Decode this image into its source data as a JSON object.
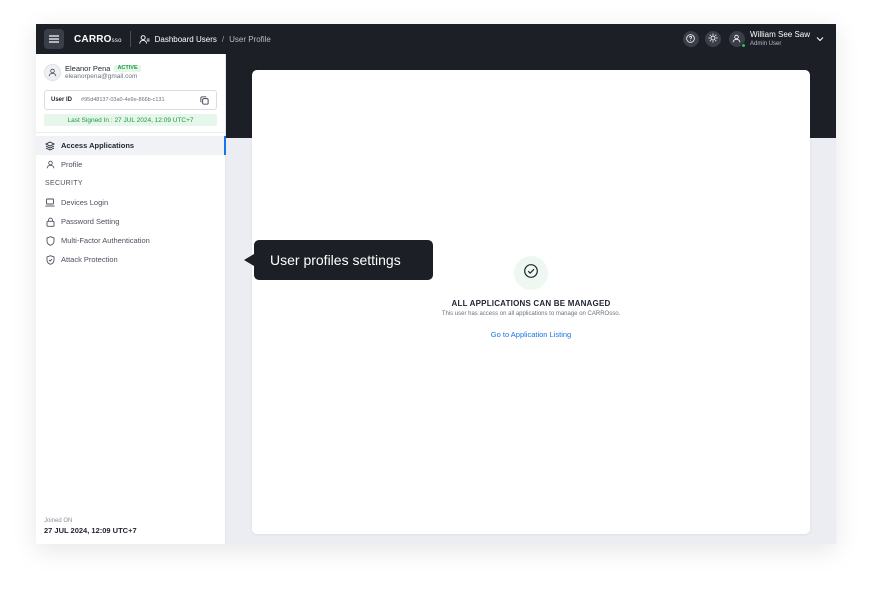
{
  "topbar": {
    "brand": "CARRO",
    "brand_suffix": "sso",
    "breadcrumb": {
      "section": "Dashboard Users",
      "separator": "/",
      "current": "User Profile"
    },
    "icons": [
      "menu-icon",
      "users-icon",
      "help-icon",
      "sun-icon",
      "user-icon",
      "chevron-down-icon"
    ],
    "user": {
      "name": "William See Saw",
      "role": "Admin User"
    }
  },
  "sidebar": {
    "profile": {
      "name": "Eleanor Pena",
      "status": "ACTIVE",
      "email": "eleanorpena@gmail.com"
    },
    "user_id": {
      "label": "User ID",
      "value": "#95d48137-03a0-4e9e-866b-c131"
    },
    "last_signed": "Last Signed In : 27 JUL 2024, 12:09 UTC+7",
    "nav": [
      {
        "label": "Access Applications",
        "icon": "layers-icon",
        "active": true
      },
      {
        "label": "Profile",
        "icon": "user-icon"
      }
    ],
    "security_label": "SECURITY",
    "security_nav": [
      {
        "label": "Devices Login",
        "icon": "laptop-icon"
      },
      {
        "label": "Password Setting",
        "icon": "lock-icon"
      },
      {
        "label": "Multi-Factor Authentication",
        "icon": "shield-icon"
      },
      {
        "label": "Attack Protection",
        "icon": "shield-check-icon"
      }
    ],
    "joined": {
      "label": "Joined ON",
      "value": "27 JUL 2024, 12:09 UTC+7"
    }
  },
  "main": {
    "empty_state": {
      "title": "ALL APPLICATIONS CAN BE MANAGED",
      "subtitle": "This user has access on all applications to manage on CARROsso.",
      "link": "Go to Application Listing"
    }
  },
  "tooltip": {
    "text": "User profiles settings"
  },
  "colors": {
    "dark": "#1c1f26",
    "accent": "#1a73e8",
    "success": "#1d9a45",
    "success_bg": "#e6f6ea"
  }
}
